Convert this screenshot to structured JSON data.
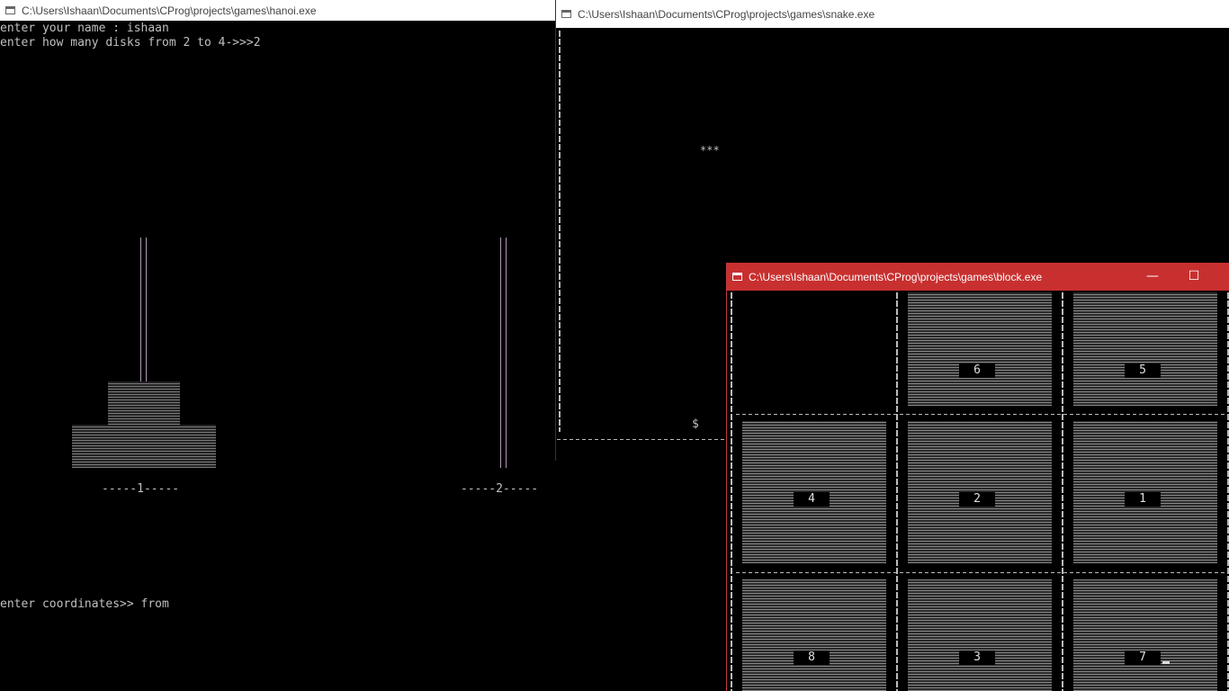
{
  "hanoi": {
    "title": "C:\\Users\\Ishaan\\Documents\\CProg\\projects\\games\\hanoi.exe",
    "line1": "enter your name : ishaan",
    "line2": "enter how many disks from 2 to 4->>>2",
    "peg1_label": "-----1-----",
    "peg2_label": "-----2-----",
    "prompt": "enter coordinates>> from",
    "disks_on_peg1": 2
  },
  "snake": {
    "title": "C:\\Users\\Ishaan\\Documents\\CProg\\projects\\games\\snake.exe",
    "snake_body": "***",
    "food": "$"
  },
  "block": {
    "title": "C:\\Users\\Ishaan\\Documents\\CProg\\projects\\games\\block.exe",
    "minimize_glyph": "—",
    "maximize_glyph": "☐",
    "tiles": [
      "",
      "6",
      "5",
      "4",
      "2",
      "1",
      "8",
      "3",
      "7"
    ]
  },
  "colors": {
    "console_text": "#c0c0c0",
    "rod": "#b09ab5",
    "active_titlebar": "#c8302f"
  }
}
